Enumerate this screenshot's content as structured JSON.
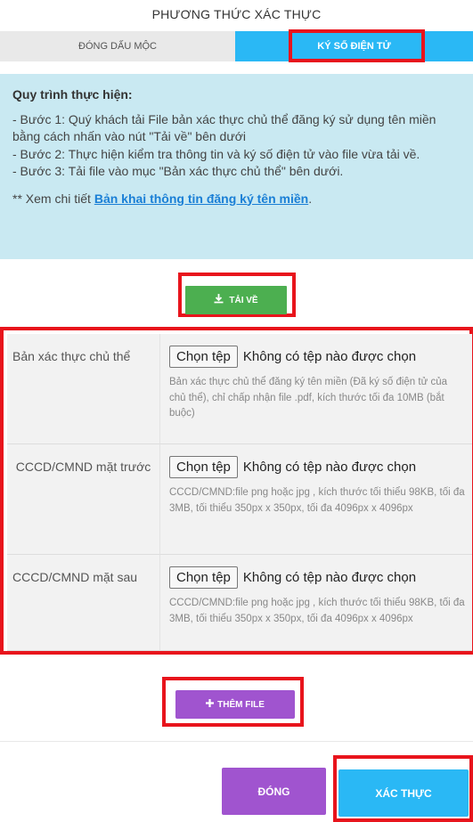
{
  "header": {
    "title": "PHƯƠNG THỨC XÁC THỰC"
  },
  "tabs": [
    {
      "label": "ĐÓNG DẤU MỘC",
      "active": false
    },
    {
      "label": "KÝ SỐ ĐIỆN TỬ",
      "active": true
    }
  ],
  "info": {
    "heading": "Quy trình thực hiện:",
    "steps": [
      "- Bước 1: Quý khách tải File bản xác thực chủ thể đăng ký sử dụng tên miền bằng cách nhấn vào nút \"Tải về\" bên dưới",
      "- Bước 2: Thực hiện kiểm tra thông tin và ký số điện tử vào file vừa tải về.",
      "- Bước 3: Tải file vào mục \"Bản xác thực chủ thể\" bên dưới."
    ],
    "detail_prefix": "** Xem chi tiết ",
    "detail_link": "Bản khai thông tin đăng ký tên miền",
    "detail_suffix": "."
  },
  "download_button": {
    "label": "TẢI VỀ",
    "icon": "download-icon"
  },
  "files": [
    {
      "label": "Bản xác thực chủ thể",
      "choose_label": "Chọn tệp",
      "status": "Không có tệp nào được chọn",
      "hint": "Bản xác thực chủ thể đăng ký tên miền (Đã ký số điện tử của chủ thể), chỉ chấp nhận file .pdf, kích thước tối đa 10MB (bắt buộc)"
    },
    {
      "label": "CCCD/CMND mặt trước",
      "choose_label": "Chọn tệp",
      "status": "Không có tệp nào được chọn",
      "hint": "CCCD/CMND:file png hoặc jpg , kích thước tối thiểu 98KB, tối đa 3MB, tối thiểu 350px x 350px, tối đa 4096px x 4096px"
    },
    {
      "label": "CCCD/CMND mặt sau",
      "choose_label": "Chọn tệp",
      "status": "Không có tệp nào được chọn",
      "hint": "CCCD/CMND:file png hoặc jpg , kích thước tối thiểu 98KB, tối đa 3MB, tối thiểu 350px x 350px, tối đa 4096px x 4096px"
    }
  ],
  "add_file_button": {
    "label": "THÊM FILE",
    "icon": "plus-icon"
  },
  "footer": {
    "close_label": "ĐÓNG",
    "submit_label": "XÁC THỰC"
  },
  "colors": {
    "accent_blue": "#2ab8f5",
    "purple": "#a054cf",
    "green": "#4caf50",
    "highlight_red": "#e8141c",
    "info_bg": "#c9e9f2"
  }
}
